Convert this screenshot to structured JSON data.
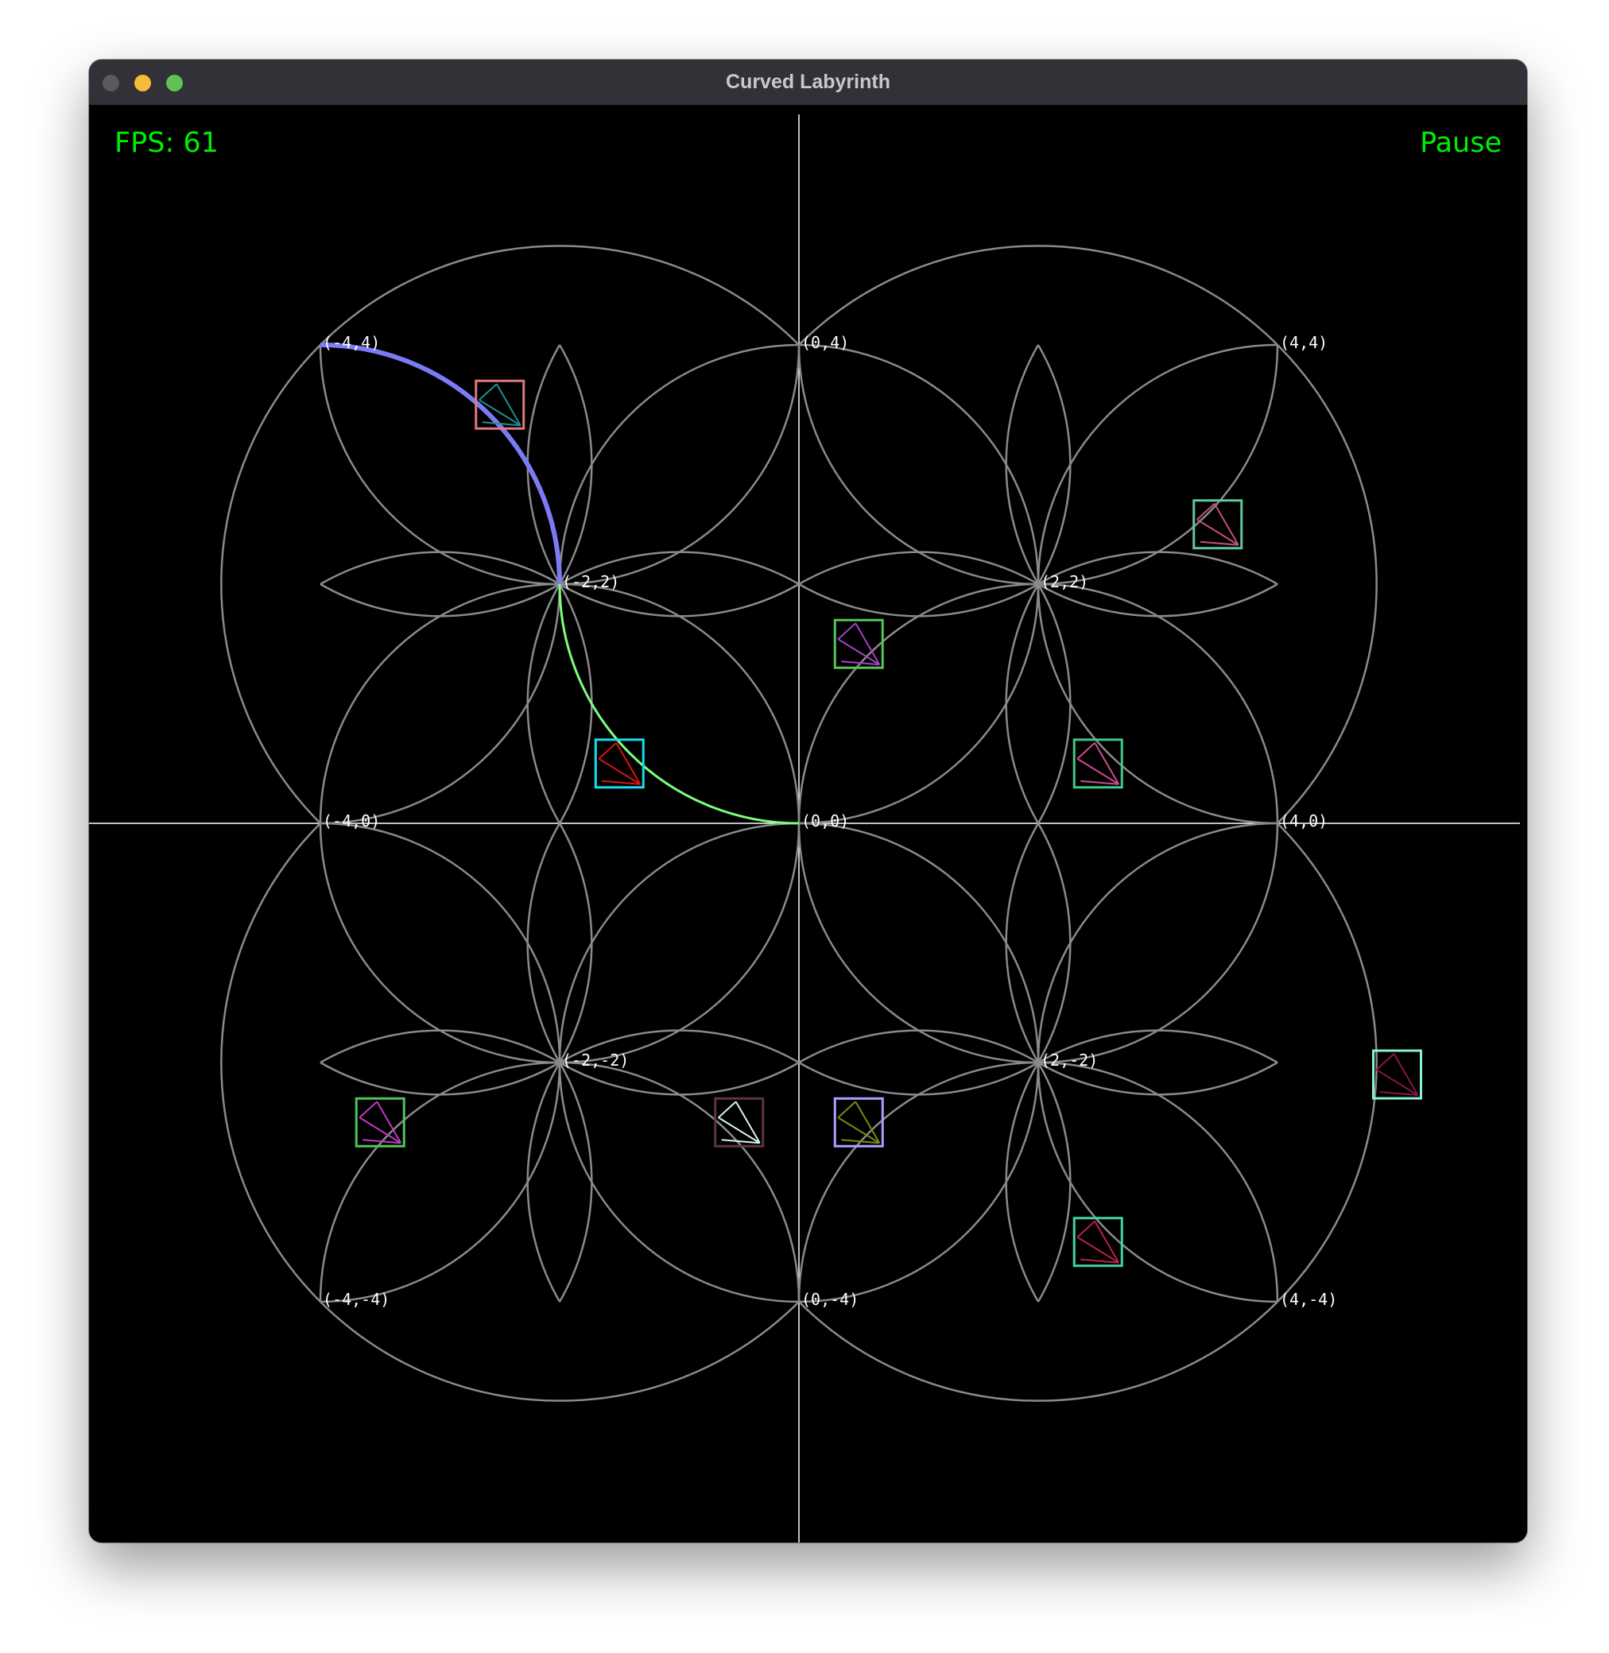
{
  "window": {
    "title": "Curved Labyrinth"
  },
  "hud": {
    "fps_label": "FPS: 61",
    "pause_label": "Pause"
  },
  "maze": {
    "nodes": [
      {
        "label": "(-4,4)",
        "x": -4,
        "y": 4
      },
      {
        "label": "(0,4)",
        "x": 0,
        "y": 4
      },
      {
        "label": "(4,4)",
        "x": 4,
        "y": 4
      },
      {
        "label": "(-2,2)",
        "x": -2,
        "y": 2
      },
      {
        "label": "(2,2)",
        "x": 2,
        "y": 2
      },
      {
        "label": "(-4,0)",
        "x": -4,
        "y": 0
      },
      {
        "label": "(0,0)",
        "x": 0,
        "y": 0
      },
      {
        "label": "(4,0)",
        "x": 4,
        "y": 0
      },
      {
        "label": "(-2,-2)",
        "x": -2,
        "y": -2
      },
      {
        "label": "(2,-2)",
        "x": 2,
        "y": -2
      },
      {
        "label": "(-4,-4)",
        "x": -4,
        "y": -4
      },
      {
        "label": "(0,-4)",
        "x": 0,
        "y": -4
      },
      {
        "label": "(4,-4)",
        "x": 4,
        "y": -4
      }
    ],
    "colors": {
      "track": "#8a8a8a",
      "axis": "#ffffff",
      "path_done": "#7b7bf5",
      "path_active": "#7dff7d",
      "hud": "#00ee00"
    },
    "sprites": [
      {
        "name": "sprite-1",
        "x": -2.5,
        "y": 3.5,
        "box": "#e07a7a",
        "fan": "#1e8f8f"
      },
      {
        "name": "sprite-2",
        "x": 3.5,
        "y": 2.5,
        "box": "#5fc99a",
        "fan": "#c2507a"
      },
      {
        "name": "sprite-3",
        "x": 0.5,
        "y": 1.5,
        "box": "#56c457",
        "fan": "#a83ec9"
      },
      {
        "name": "sprite-player",
        "x": -1.5,
        "y": 0.5,
        "box": "#12e0ef",
        "fan": "#e01010"
      },
      {
        "name": "sprite-4",
        "x": 2.5,
        "y": 0.5,
        "box": "#40c78b",
        "fan": "#d04a92"
      },
      {
        "name": "sprite-5",
        "x": 5.0,
        "y": -2.1,
        "box": "#88f2d6",
        "fan": "#8a1640"
      },
      {
        "name": "sprite-6",
        "x": -3.5,
        "y": -2.5,
        "box": "#4fc45a",
        "fan": "#c238c2"
      },
      {
        "name": "sprite-7",
        "x": -0.5,
        "y": -2.5,
        "box": "#5c3444",
        "fan": "#d6f4ee"
      },
      {
        "name": "sprite-8",
        "x": 0.5,
        "y": -2.5,
        "box": "#a7a2ff",
        "fan": "#7a8a12"
      },
      {
        "name": "sprite-9",
        "x": 2.5,
        "y": -3.5,
        "box": "#40d3a6",
        "fan": "#b82244"
      }
    ]
  }
}
